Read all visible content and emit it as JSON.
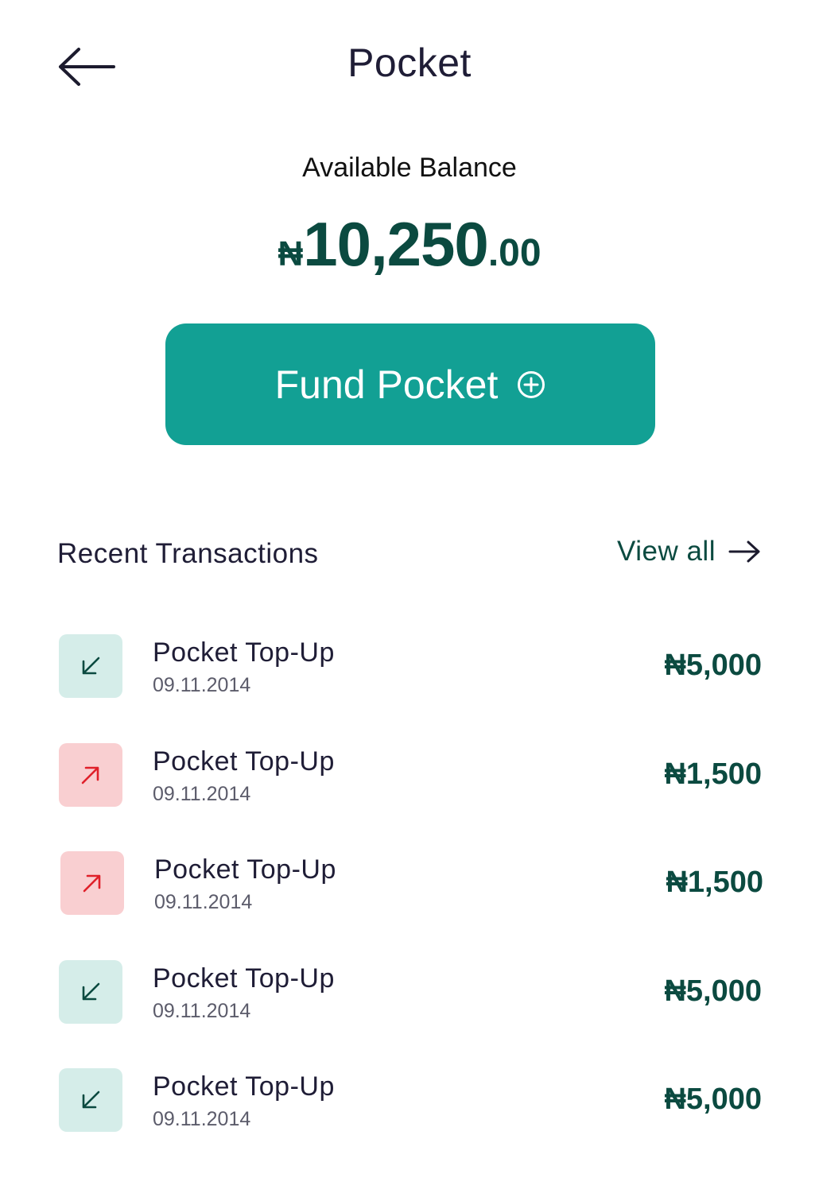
{
  "header": {
    "title": "Pocket",
    "back_icon": "arrow-left-icon"
  },
  "balance": {
    "label": "Available Balance",
    "currency": "₦",
    "whole": "10,250",
    "decimal": ".00"
  },
  "fund_button": {
    "label": "Fund Pocket",
    "icon": "plus-circle-icon"
  },
  "recent": {
    "title": "Recent Transactions",
    "view_all": "View all",
    "view_all_icon": "arrow-right-icon"
  },
  "colors": {
    "accent": "#12a094",
    "brand_dark": "#0b4a40",
    "incoming_bg": "#d5ede9",
    "outgoing_bg": "#f9cfd1",
    "outgoing_arrow": "#e0202a"
  },
  "transactions": [
    {
      "type": "in",
      "icon": "arrow-down-left-icon",
      "title": "Pocket Top-Up",
      "date": "09.11.2014",
      "amount": "₦5,000"
    },
    {
      "type": "out",
      "icon": "arrow-up-right-icon",
      "title": "Pocket Top-Up",
      "date": "09.11.2014",
      "amount": "₦1,500"
    },
    {
      "type": "out",
      "icon": "arrow-up-right-icon",
      "title": "Pocket Top-Up",
      "date": "09.11.2014",
      "amount": "₦1,500"
    },
    {
      "type": "in",
      "icon": "arrow-down-left-icon",
      "title": "Pocket Top-Up",
      "date": "09.11.2014",
      "amount": "₦5,000"
    },
    {
      "type": "in",
      "icon": "arrow-down-left-icon",
      "title": "Pocket Top-Up",
      "date": "09.11.2014",
      "amount": "₦5,000"
    }
  ]
}
